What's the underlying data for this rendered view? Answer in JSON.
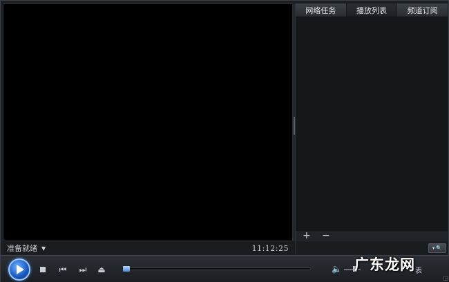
{
  "panel": {
    "tabs": [
      {
        "label": "网络任务"
      },
      {
        "label": "播放列表"
      },
      {
        "label": "频道订阅"
      }
    ],
    "add_glyph": "+",
    "remove_glyph": "−"
  },
  "status": {
    "text": "准备就绪",
    "caret": "▼",
    "time": "11:12:25"
  },
  "search": {
    "caret": "▾",
    "icon": "🔍"
  },
  "controls": {
    "prev_glyph": "⏮",
    "next_glyph": "⏭",
    "eject_glyph": "⏏",
    "volume_glyph": "🔈",
    "playlist_label": "表",
    "progress_fraction": 0.0,
    "volume_fraction": 0.55,
    "corner_glyph": "◲"
  },
  "watermark": "广东龙网",
  "colors": {
    "accent": "#1e5fc4",
    "background": "#1c1f22",
    "video": "#000000"
  }
}
